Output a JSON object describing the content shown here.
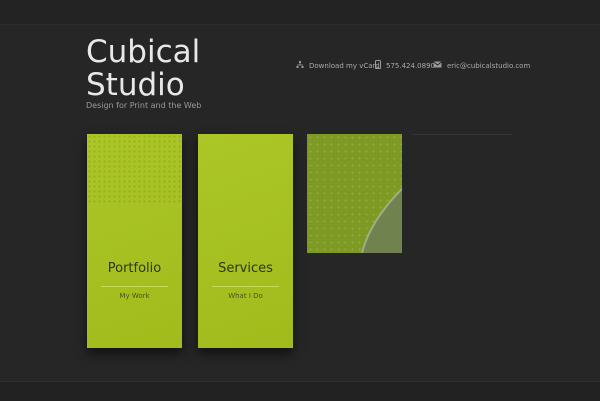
{
  "header": {
    "title": "Cubical Studio",
    "tagline": "Design for Print and the Web"
  },
  "contact": {
    "vcard": {
      "icon": "network-icon",
      "label": "Download my vCard"
    },
    "phone": {
      "icon": "phone-icon",
      "label": "575.424.0890"
    },
    "email": {
      "icon": "envelope-icon",
      "label": "eric@cubicalstudio.com"
    }
  },
  "panels": [
    {
      "title": "Portfolio",
      "subtitle": "My Work"
    },
    {
      "title": "Services",
      "subtitle": "What I Do"
    }
  ],
  "colors": {
    "background": "#262626",
    "panel": "#a7c31c",
    "feature": "#7f9a24",
    "text": "#e8e8e8"
  }
}
